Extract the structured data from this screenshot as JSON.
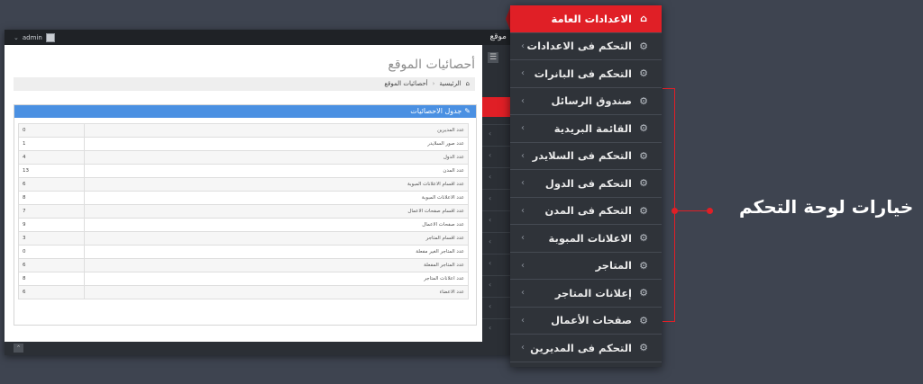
{
  "window": {
    "user": "admin",
    "site_fragment": "موقع",
    "page_title": "أحصائيات الموقع",
    "breadcrumbs": [
      "الرئيسية",
      "أحصائيات الموقع"
    ],
    "panel_title": "جدول الاحصائيات",
    "stats": [
      {
        "label": "عدد المديرين",
        "value": "0"
      },
      {
        "label": "عدد صور السلايدر",
        "value": "1"
      },
      {
        "label": "عدد الدول",
        "value": "4"
      },
      {
        "label": "عدد المدن",
        "value": "13"
      },
      {
        "label": "عدد اقسام الاعلانات المبوبة",
        "value": "6"
      },
      {
        "label": "عدد الاعلانات المبوبة",
        "value": "8"
      },
      {
        "label": "عدد اقسام صفحات الاعمال",
        "value": "7"
      },
      {
        "label": "عدد صفحات الاعمال",
        "value": "9"
      },
      {
        "label": "عدد اقسام المتاجر",
        "value": "3"
      },
      {
        "label": "عدد المتاجر الغير مفعلة",
        "value": "0"
      },
      {
        "label": "عدد المتاجر المفعلة",
        "value": "6"
      },
      {
        "label": "عدد اعلانات المتاجر",
        "value": "8"
      },
      {
        "label": "عدد الاعضاء",
        "value": "6"
      }
    ]
  },
  "menu": {
    "items": [
      {
        "label": "الاعدادات العامة",
        "icon": "home-icon",
        "active": true
      },
      {
        "label": "التحكم فى الاعدادات",
        "icon": "cogs-icon",
        "active": false
      },
      {
        "label": "التحكم فى البانرات",
        "icon": "cogs-icon",
        "active": false
      },
      {
        "label": "صندوق الرسائل",
        "icon": "cogs-icon",
        "active": false
      },
      {
        "label": "القائمة البريدية",
        "icon": "cogs-icon",
        "active": false
      },
      {
        "label": "التحكم فى السلايدر",
        "icon": "cogs-icon",
        "active": false
      },
      {
        "label": "التحكم فى الدول",
        "icon": "cogs-icon",
        "active": false
      },
      {
        "label": "التحكم فى المدن",
        "icon": "cogs-icon",
        "active": false
      },
      {
        "label": "الاعلانات المبوبة",
        "icon": "cogs-icon",
        "active": false
      },
      {
        "label": "المتاجر",
        "icon": "cogs-icon",
        "active": false
      },
      {
        "label": "إعلانات المتاجر",
        "icon": "cogs-icon",
        "active": false
      },
      {
        "label": "صفحات الأعمال",
        "icon": "cogs-icon",
        "active": false
      },
      {
        "label": "التحكم فى المديرين",
        "icon": "cogs-icon",
        "active": false
      }
    ]
  },
  "callout": {
    "text": "خيارات لوحة التحكم"
  },
  "colors": {
    "accent": "#e01f26",
    "panel_head": "#4a90e2",
    "menu_bg": "#2f3339",
    "page_bg": "#3e4450"
  }
}
